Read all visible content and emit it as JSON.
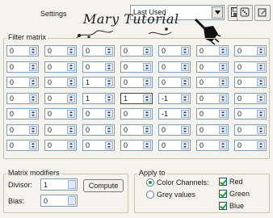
{
  "header": {
    "settings_label": "Settings",
    "preset_value": "Last Used",
    "watermark": "Mary Tutorial"
  },
  "matrix": {
    "title": "Filter matrix",
    "rows": [
      [
        "0",
        "0",
        "0",
        "0",
        "0",
        "0",
        "0"
      ],
      [
        "0",
        "0",
        "0",
        "0",
        "0",
        "0",
        "0"
      ],
      [
        "0",
        "0",
        "1",
        "0",
        "0",
        "0",
        "0"
      ],
      [
        "0",
        "0",
        "1",
        "1",
        "-1",
        "0",
        "0"
      ],
      [
        "0",
        "0",
        "0",
        "0",
        "-1",
        "0",
        "0"
      ],
      [
        "0",
        "0",
        "0",
        "0",
        "0",
        "0",
        "0"
      ],
      [
        "0",
        "0",
        "0",
        "0",
        "0",
        "0",
        "0"
      ]
    ]
  },
  "modifiers": {
    "title": "Matrix modifiers",
    "divisor_label": "Divisor:",
    "divisor_value": "1",
    "bias_label": "Bias:",
    "bias_value": "0",
    "compute_label": "Compute"
  },
  "apply_to": {
    "title": "Apply to",
    "color_channels_label": "Color Channels:",
    "grey_values_label": "Grey values",
    "red_label": "Red",
    "green_label": "Green",
    "blue_label": "Blue"
  },
  "colors": {
    "panel_bg": "#f4f3ee",
    "field_border": "#7f9db9",
    "check_color": "#21a121"
  }
}
